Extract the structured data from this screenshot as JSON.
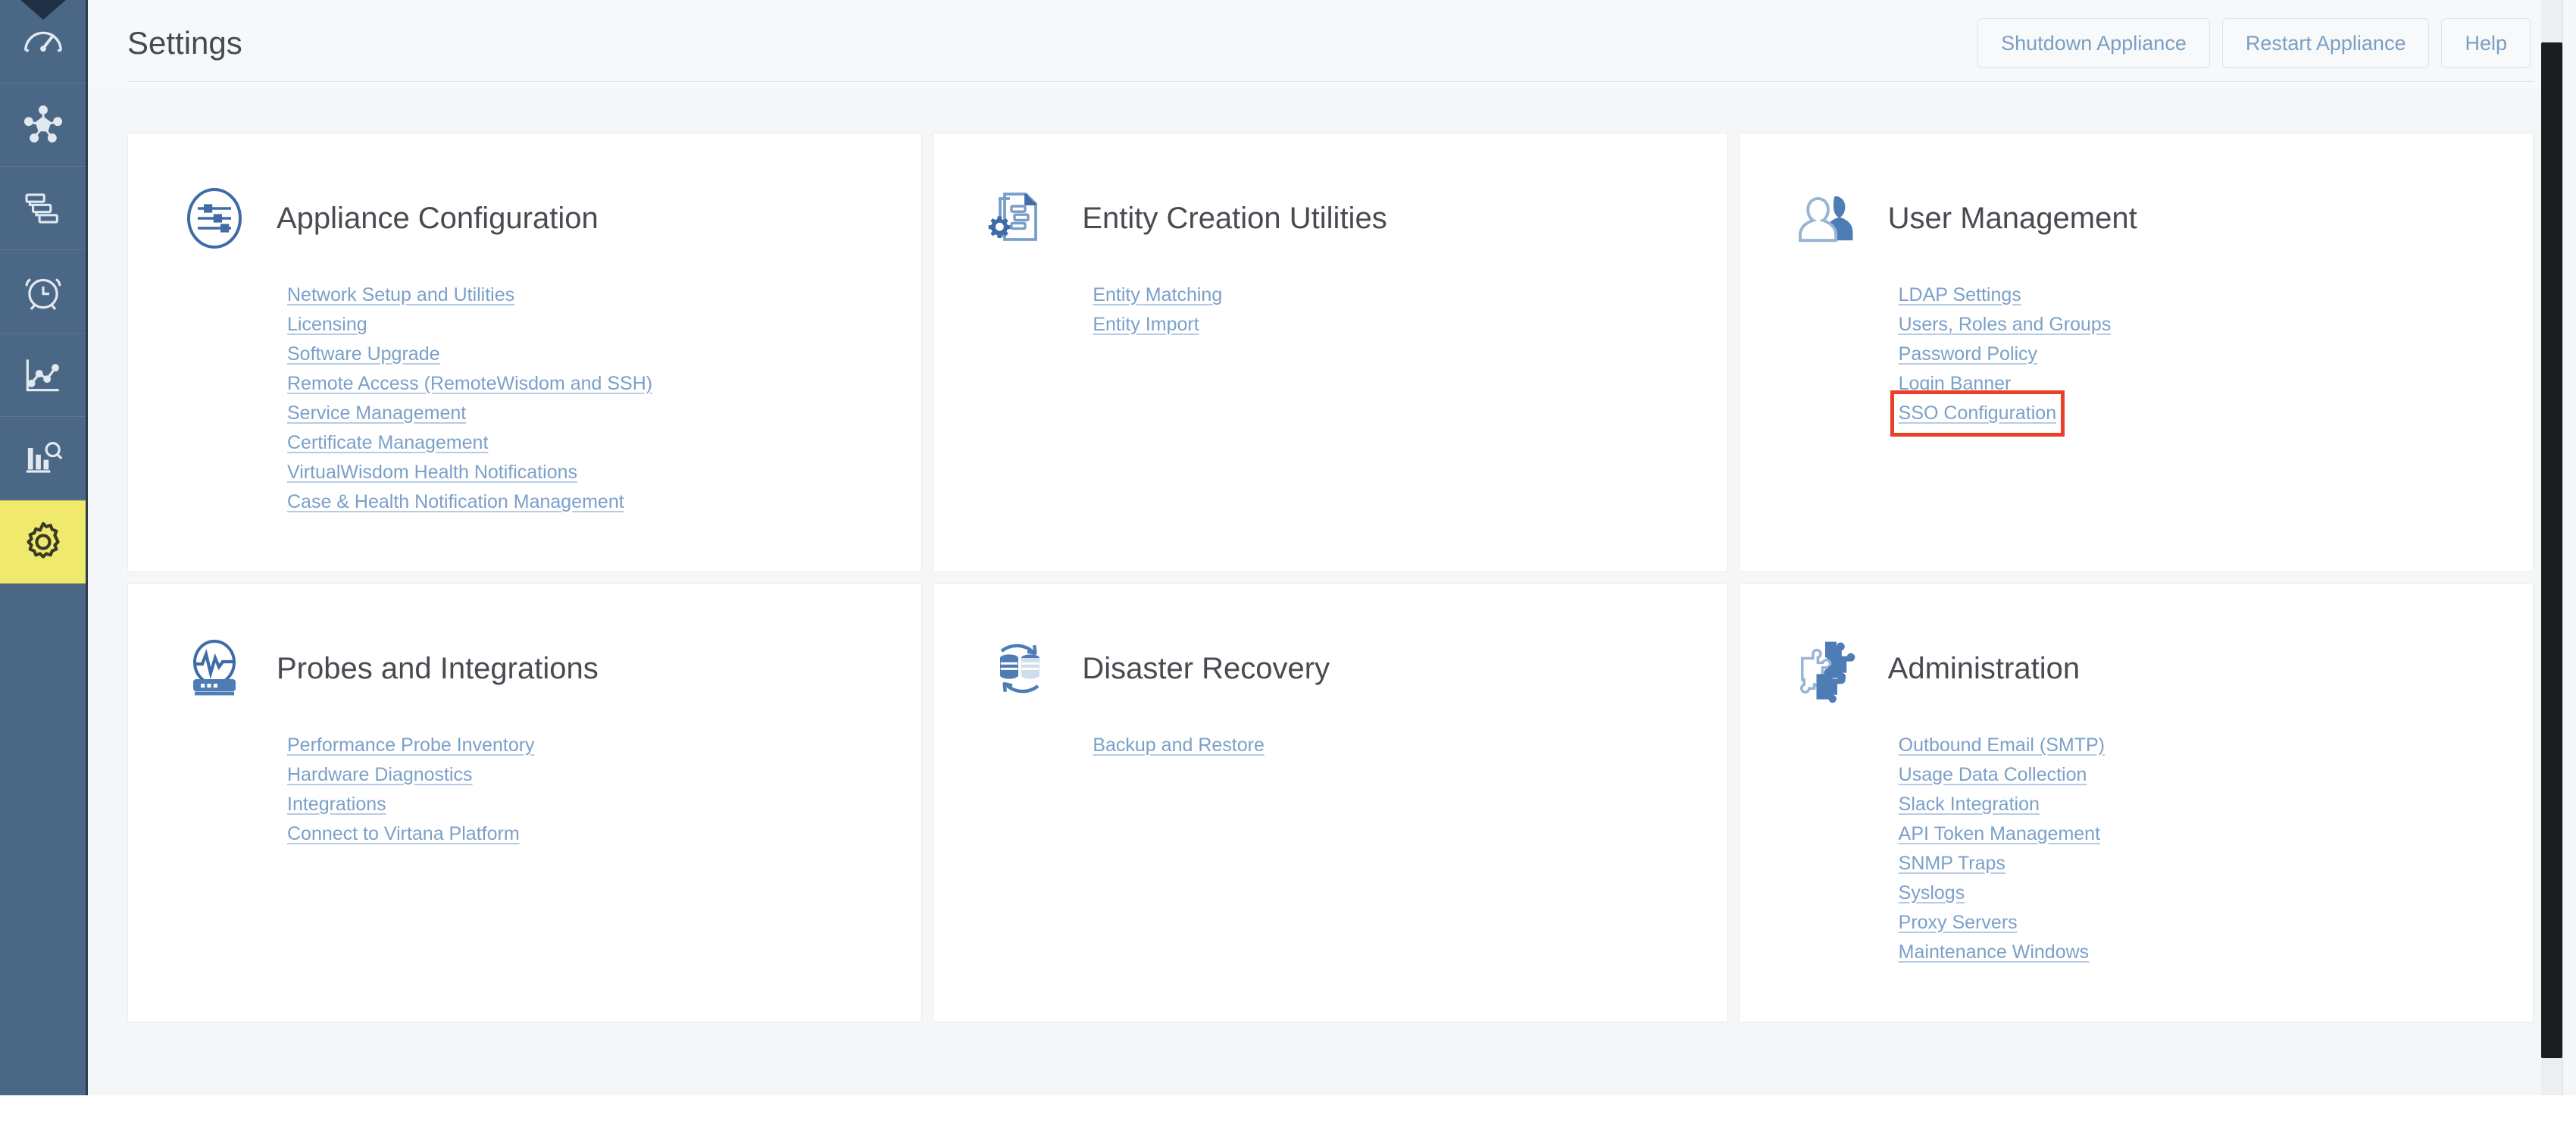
{
  "header": {
    "title": "Settings",
    "buttons": [
      {
        "label": "Shutdown Appliance",
        "name": "shutdown-appliance-button"
      },
      {
        "label": "Restart Appliance",
        "name": "restart-appliance-button"
      },
      {
        "label": "Help",
        "name": "help-button"
      }
    ]
  },
  "sidebar": {
    "background": "#4a6785",
    "active_background": "#efe96e",
    "items": [
      {
        "icon": "gauge-icon",
        "active": false
      },
      {
        "icon": "topology-icon",
        "active": false
      },
      {
        "icon": "gantt-chart-icon",
        "active": false
      },
      {
        "icon": "alarm-clock-icon",
        "active": false
      },
      {
        "icon": "line-chart-icon",
        "active": false
      },
      {
        "icon": "bar-chart-search-icon",
        "active": false
      },
      {
        "icon": "gear-icon",
        "active": true
      }
    ]
  },
  "cards": [
    {
      "title": "Appliance Configuration",
      "icon": "sliders-oval-icon",
      "links": [
        "Network Setup and Utilities",
        "Licensing",
        "Software Upgrade",
        "Remote Access (RemoteWisdom and SSH)",
        "Service Management",
        "Certificate Management",
        "VirtualWisdom Health Notifications",
        "Case & Health Notification Management"
      ]
    },
    {
      "title": "Entity Creation Utilities",
      "icon": "document-gear-icon",
      "links": [
        "Entity Matching",
        "Entity Import"
      ]
    },
    {
      "title": "User Management",
      "icon": "users-icon",
      "links": [
        "LDAP Settings",
        "Users, Roles and Groups",
        "Password Policy",
        "Login Banner",
        "SSO Configuration"
      ],
      "highlighted_link": "SSO Configuration",
      "highlight_color": "#e8402a"
    },
    {
      "title": "Probes and Integrations",
      "icon": "probe-heartbeat-icon",
      "links": [
        "Performance Probe Inventory",
        "Hardware Diagnostics",
        "Integrations",
        "Connect to Virtana Platform"
      ]
    },
    {
      "title": "Disaster Recovery",
      "icon": "database-sync-icon",
      "links": [
        "Backup and Restore"
      ]
    },
    {
      "title": "Administration",
      "icon": "puzzle-pieces-icon",
      "links": [
        "Outbound Email (SMTP)",
        "Usage Data Collection",
        "Slack Integration",
        "API Token Management",
        "SNMP Traps",
        "Syslogs",
        "Proxy Servers",
        "Maintenance Windows"
      ]
    }
  ],
  "scrollbar": {
    "name": "vertical-scrollbar"
  }
}
